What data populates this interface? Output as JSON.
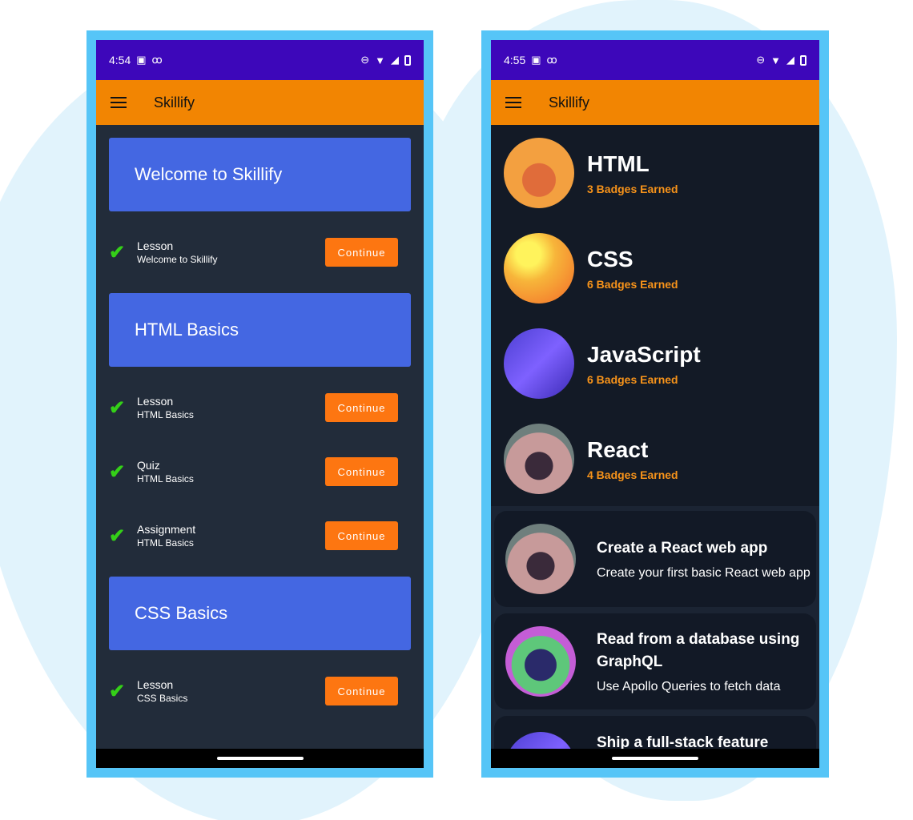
{
  "colors": {
    "status_bar": "#3d07ba",
    "app_bar": "#f28502",
    "section_card": "#4467e2",
    "continue_button": "#fd7611",
    "check": "#34d018",
    "badge_count": "#f7931a",
    "phone_frame": "#56c5f7"
  },
  "left_phone": {
    "status": {
      "time": "4:54",
      "left_icons": [
        "sim-icon",
        "voicemail-icon"
      ],
      "right_icons": [
        "dnd-icon",
        "wifi-icon",
        "signal-icon",
        "battery-icon"
      ]
    },
    "app_bar": {
      "menu_icon": "hamburger-icon",
      "title": "Skillify"
    },
    "sections": [
      {
        "title": "Welcome to Skillify",
        "items": [
          {
            "type": "Lesson",
            "sub": "Welcome to Skillify",
            "button": "Continue",
            "completed": true
          }
        ]
      },
      {
        "title": "HTML Basics",
        "items": [
          {
            "type": "Lesson",
            "sub": "HTML Basics",
            "button": "Continue",
            "completed": true
          },
          {
            "type": "Quiz",
            "sub": "HTML Basics",
            "button": "Continue",
            "completed": true
          },
          {
            "type": "Assignment",
            "sub": "HTML Basics",
            "button": "Continue",
            "completed": true
          }
        ]
      },
      {
        "title": "CSS Basics",
        "items": [
          {
            "type": "Lesson",
            "sub": "CSS Basics",
            "button": "Continue",
            "completed": true
          }
        ]
      }
    ]
  },
  "right_phone": {
    "status": {
      "time": "4:55",
      "left_icons": [
        "sim-icon",
        "voicemail-icon"
      ],
      "right_icons": [
        "dnd-icon",
        "wifi-icon",
        "signal-icon",
        "battery-icon"
      ]
    },
    "app_bar": {
      "menu_icon": "hamburger-icon",
      "title": "Skillify"
    },
    "badges": [
      {
        "title": "HTML",
        "count": "3 Badges Earned",
        "avatar": "fox-goggles-avatar"
      },
      {
        "title": "CSS",
        "count": "6 Badges Earned",
        "avatar": "bear-sailor-avatar"
      },
      {
        "title": "JavaScript",
        "count": "6 Badges Earned",
        "avatar": "cubes-avatar"
      },
      {
        "title": "React",
        "count": "4 Badges Earned",
        "avatar": "girl-desk-avatar"
      }
    ],
    "projects": [
      {
        "title": "Create a React web app",
        "desc": "Create your first basic React web app",
        "avatar": "girl-desk-avatar"
      },
      {
        "title": "Read from a database using GraphQL",
        "desc": "Use Apollo Queries to fetch data",
        "avatar": "house-avatar"
      },
      {
        "title": "Ship a full-stack feature",
        "desc": "",
        "avatar": "partial-avatar"
      }
    ]
  }
}
